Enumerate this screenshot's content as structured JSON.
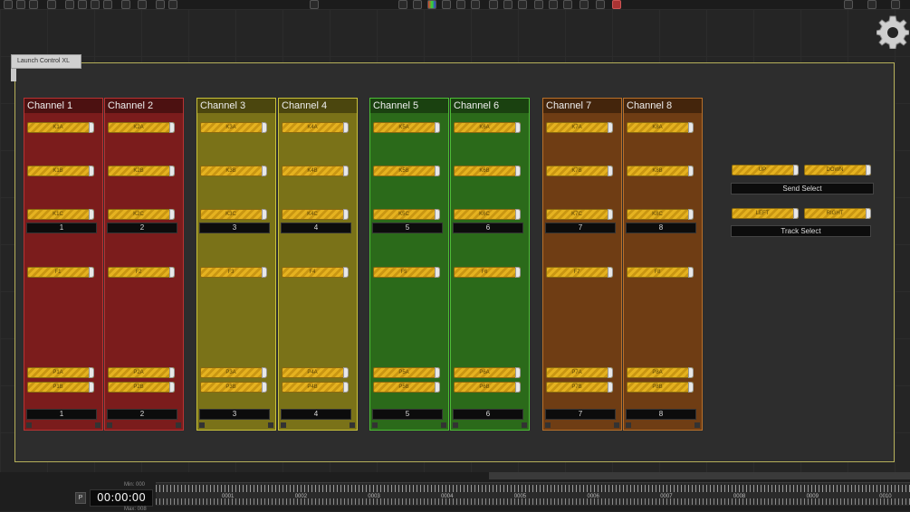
{
  "container": {
    "title": "Launch Control XL"
  },
  "channels": [
    {
      "name": "Channel  1",
      "k1": "K1A",
      "k2": "K1B",
      "k3": "K1C",
      "mid": "1",
      "f": "F1",
      "pa": "P1A",
      "pb": "P1B",
      "bottom": "1",
      "color": "red"
    },
    {
      "name": "Channel  2",
      "k1": "K2A",
      "k2": "K2B",
      "k3": "K2C",
      "mid": "2",
      "f": "F2",
      "pa": "P2A",
      "pb": "P2B",
      "bottom": "2",
      "color": "red"
    },
    {
      "name": "Channel  3",
      "k1": "K3A",
      "k2": "K3B",
      "k3": "K3C",
      "mid": "3",
      "f": "F3",
      "pa": "P3A",
      "pb": "P3B",
      "bottom": "3",
      "color": "yellow"
    },
    {
      "name": "Channel  4",
      "k1": "K4A",
      "k2": "K4B",
      "k3": "K4C",
      "mid": "4",
      "f": "F4",
      "pa": "P4A",
      "pb": "P4B",
      "bottom": "4",
      "color": "yellow"
    },
    {
      "name": "Channel  5",
      "k1": "K5A",
      "k2": "K5B",
      "k3": "K5C",
      "mid": "5",
      "f": "F5",
      "pa": "P5A",
      "pb": "P5B",
      "bottom": "5",
      "color": "green"
    },
    {
      "name": "Channel  6",
      "k1": "K6A",
      "k2": "K6B",
      "k3": "K6C",
      "mid": "6",
      "f": "F6",
      "pa": "P6A",
      "pb": "P6B",
      "bottom": "6",
      "color": "green"
    },
    {
      "name": "Channel  7",
      "k1": "K7A",
      "k2": "K7B",
      "k3": "K7C",
      "mid": "7",
      "f": "F7",
      "pa": "P7A",
      "pb": "P7B",
      "bottom": "7",
      "color": "orange"
    },
    {
      "name": "Channel  8",
      "k1": "K8A",
      "k2": "K8B",
      "k3": "K8C",
      "mid": "8",
      "f": "F8",
      "pa": "P8A",
      "pb": "P8B",
      "bottom": "8",
      "color": "orange"
    }
  ],
  "send_select": {
    "up": "UP",
    "down": "DOWN",
    "label": "Send  Select"
  },
  "track_select": {
    "left": "LEFT",
    "right": "RIGHT",
    "label": "Track  Select"
  },
  "transport": {
    "play_button": "P",
    "timecode": "00:00:00",
    "min_label": "Min: 000",
    "max_label": "Max: 008",
    "ruler_labels": [
      "0001",
      "0002",
      "0003",
      "0004",
      "0005",
      "0006",
      "0007",
      "0008",
      "0009",
      "0010"
    ]
  },
  "icons": {
    "settings": "gear-icon"
  },
  "colors": {
    "red": "#7b1c1c",
    "yellow": "#7a7218",
    "green": "#2b6a1a",
    "orange": "#6f3d14",
    "knob": "#e5b220",
    "container_border": "#b6b05a"
  }
}
